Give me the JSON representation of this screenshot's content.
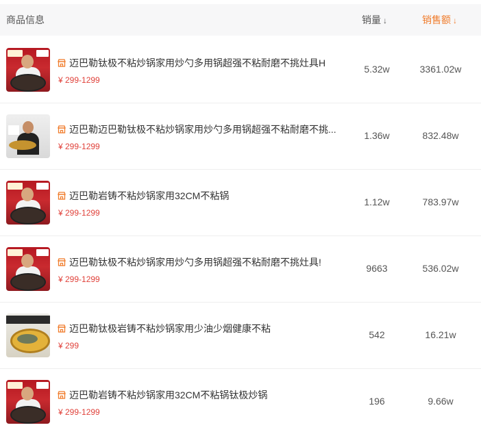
{
  "header": {
    "product_info": "商品信息",
    "sales_volume": "销量",
    "sales_amount": "销售额",
    "sort_arrow": "↓"
  },
  "colors": {
    "accent": "#f07b2a",
    "price": "#e0413a"
  },
  "rows": [
    {
      "thumb": "red-chef-pan",
      "icon": "shop-icon",
      "title": "迈巴勒钛极不粘炒锅家用炒勺多用锅超强不粘耐磨不挑灶具H",
      "price": "¥ 299-1299",
      "sales": "5.32w",
      "amount": "3361.02w"
    },
    {
      "thumb": "grey-chef-pan",
      "icon": "shop-icon",
      "title": "迈巴勒迈巴勒钛极不粘炒锅家用炒勺多用锅超强不粘耐磨不挑...",
      "price": "¥ 299-1299",
      "sales": "1.36w",
      "amount": "832.48w"
    },
    {
      "thumb": "red-chef-pan",
      "icon": "shop-icon",
      "title": "迈巴勒岩铸不粘炒锅家用32CM不粘锅",
      "price": "¥ 299-1299",
      "sales": "1.12w",
      "amount": "783.97w"
    },
    {
      "thumb": "red-chef-pan",
      "icon": "shop-icon",
      "title": "迈巴勒钛极不粘炒锅家用炒勺多用锅超强不粘耐磨不挑灶具!",
      "price": "¥ 299-1299",
      "sales": "9663",
      "amount": "536.02w"
    },
    {
      "thumb": "yellow-bowl",
      "icon": "shop-icon",
      "title": "迈巴勒钛极岩铸不粘炒锅家用少油少烟健康不粘",
      "price": "¥ 299",
      "sales": "542",
      "amount": "16.21w"
    },
    {
      "thumb": "red-chef-pan",
      "icon": "shop-icon",
      "title": "迈巴勒岩铸不粘炒锅家用32CM不粘锅钛极炒锅",
      "price": "¥ 299-1299",
      "sales": "196",
      "amount": "9.66w"
    }
  ]
}
